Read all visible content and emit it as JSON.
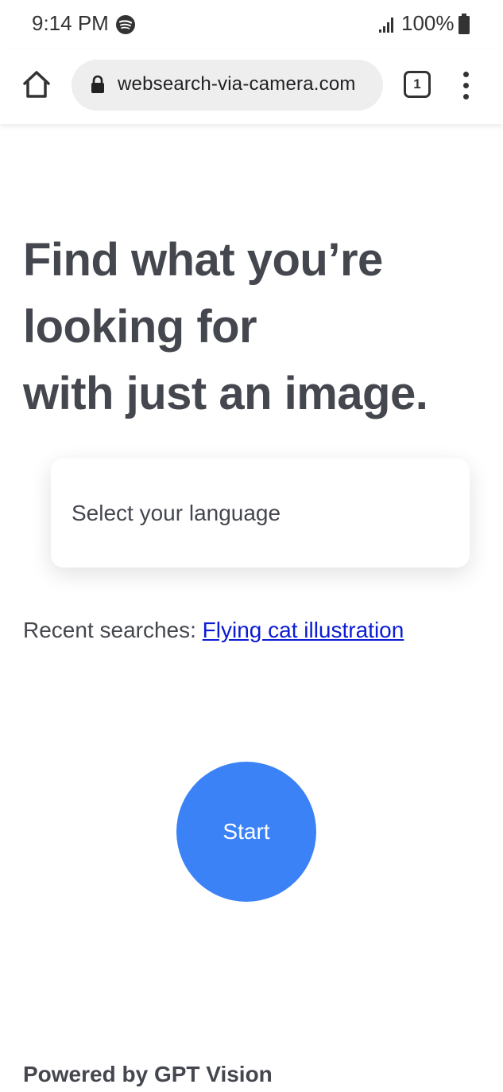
{
  "status_bar": {
    "time": "9:14 PM",
    "battery": "100%",
    "icons": [
      "spotify-icon",
      "signal-icon",
      "battery-icon"
    ]
  },
  "browser": {
    "url": "websearch-via-camera.com",
    "tab_count": "1",
    "icons": [
      "home-icon",
      "lock-icon",
      "tabs-icon",
      "more-vert-icon"
    ]
  },
  "hero": {
    "line1": "Find what you’re",
    "line2": "looking for",
    "line3": "with just an image."
  },
  "language_select": {
    "label": "Select your language"
  },
  "recent": {
    "label": "Recent searches:",
    "link": "Flying cat illustration"
  },
  "start_button": {
    "label": "Start",
    "color": "#3b82f6"
  },
  "footer": {
    "text": "Powered by GPT Vision"
  }
}
